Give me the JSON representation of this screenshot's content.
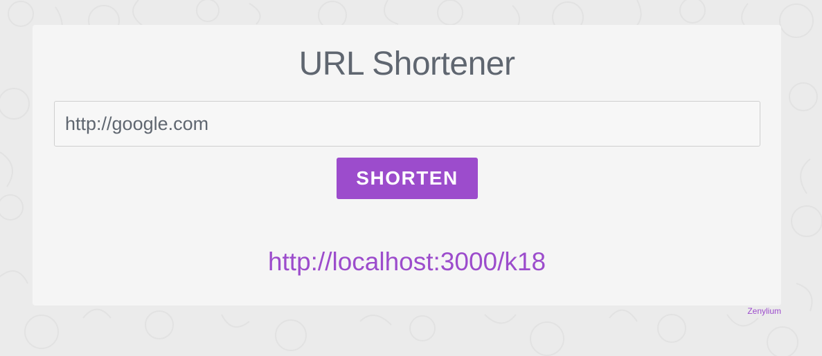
{
  "page": {
    "background_color": "#ebebeb",
    "card_color": "#f5f5f5",
    "accent_color": "#9c4ccc"
  },
  "header": {
    "title": "URL Shortener"
  },
  "form": {
    "url_value": "http://google.com",
    "submit_label": "SHORTEN"
  },
  "result": {
    "short_url": "http://localhost:3000/k18"
  },
  "footer": {
    "credit": "Zenylium"
  }
}
